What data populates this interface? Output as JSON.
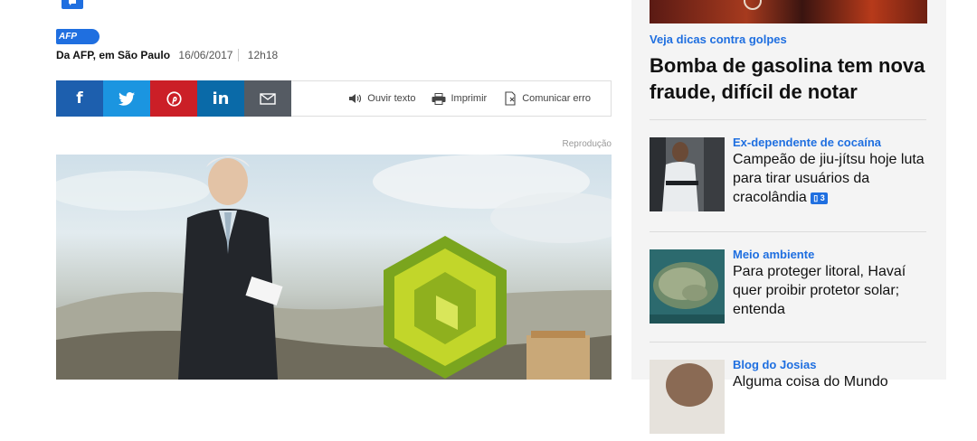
{
  "article": {
    "comment_count_top": "",
    "agency_logo": "AFP",
    "source": "Da AFP, em São Paulo",
    "date": "16/06/2017",
    "time": "12h18",
    "photo_credit": "Reprodução"
  },
  "share": {
    "facebook_icon": "f",
    "twitter_icon": "twitter-bird",
    "pinterest_icon": "pinterest-p",
    "linkedin_icon": "in",
    "email_icon": "envelope",
    "listen_label": "Ouvir texto",
    "print_label": "Imprimir",
    "report_label": "Comunicar erro"
  },
  "sidebar": {
    "promo": {
      "kicker": "Veja dicas contra golpes",
      "title": "Bomba de gasolina tem nova fraude, difícil de notar"
    },
    "items": [
      {
        "kicker": "Ex-dependente de cocaína",
        "title": "Campeão de jiu-jítsu hoje luta para tirar usuários da cracolândia",
        "comments": "3"
      },
      {
        "kicker": "Meio ambiente",
        "title": "Para proteger litoral, Havaí quer proibir protetor solar; entenda",
        "comments": ""
      },
      {
        "kicker": "Blog do Josias",
        "title": "Alguma coisa do Mundo",
        "comments": ""
      }
    ]
  },
  "colors": {
    "accent": "#1f6fe0",
    "facebook": "#1d5fae",
    "twitter": "#1b95e0",
    "pinterest": "#cb1f27",
    "linkedin": "#0a6aa8",
    "email": "#555b63"
  }
}
